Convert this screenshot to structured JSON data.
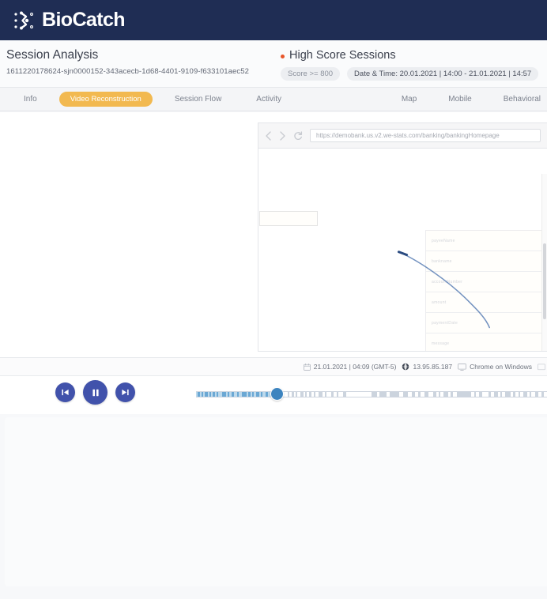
{
  "brand": {
    "name": "BioCatch",
    "logo_icon": "biocatch-node-logo"
  },
  "session": {
    "title": "Session Analysis",
    "id": "1611220178624-sjn0000152-343acecb-1d68-4401-9109-f633101aec52"
  },
  "filter": {
    "title": "High Score Sessions",
    "score_chip": "Score >= 800",
    "date_chip": "Date & Time: 20.01.2021 | 14:00 - 21.01.2021 | 14:57"
  },
  "tabs": {
    "left": [
      {
        "label": "Info",
        "active": false
      },
      {
        "label": "Video Reconstruction",
        "active": true
      },
      {
        "label": "Session Flow",
        "active": false
      },
      {
        "label": "Activity",
        "active": false
      }
    ],
    "right": [
      {
        "label": "Map",
        "active": false
      },
      {
        "label": "Mobile",
        "active": false
      },
      {
        "label": "Behavioral",
        "active": false
      }
    ]
  },
  "browser": {
    "url": "https://demobank.us.v2.we-stats.com/banking/bankingHomepage",
    "back_icon": "chevron-left-icon",
    "forward_icon": "chevron-right-icon",
    "reload_icon": "reload-icon",
    "form_fields": [
      "payeeName",
      "bankname",
      "accountNumber",
      "amount",
      "paymentDate",
      "message"
    ]
  },
  "meta": {
    "datetime": "21.01.2021 | 04:09 (GMT-5)",
    "datetime_icon": "calendar-icon",
    "ip": "13.95.85.187",
    "ip_icon": "globe-icon",
    "device": "Chrome on Windows",
    "device_icon": "monitor-icon"
  },
  "player": {
    "prev_label": "skip-back",
    "play_label": "pause",
    "next_label": "skip-forward",
    "prev_icon": "skip-back-icon",
    "play_icon": "pause-icon",
    "next_icon": "skip-forward-icon",
    "progress_percent": 21
  },
  "colors": {
    "navy": "#1f2d54",
    "accent_amber": "#f2b950",
    "accent_orange": "#e8562a",
    "player_blue": "#4152ab",
    "handle_blue": "#3d84bf",
    "track_fill": "#bcd9ec"
  }
}
